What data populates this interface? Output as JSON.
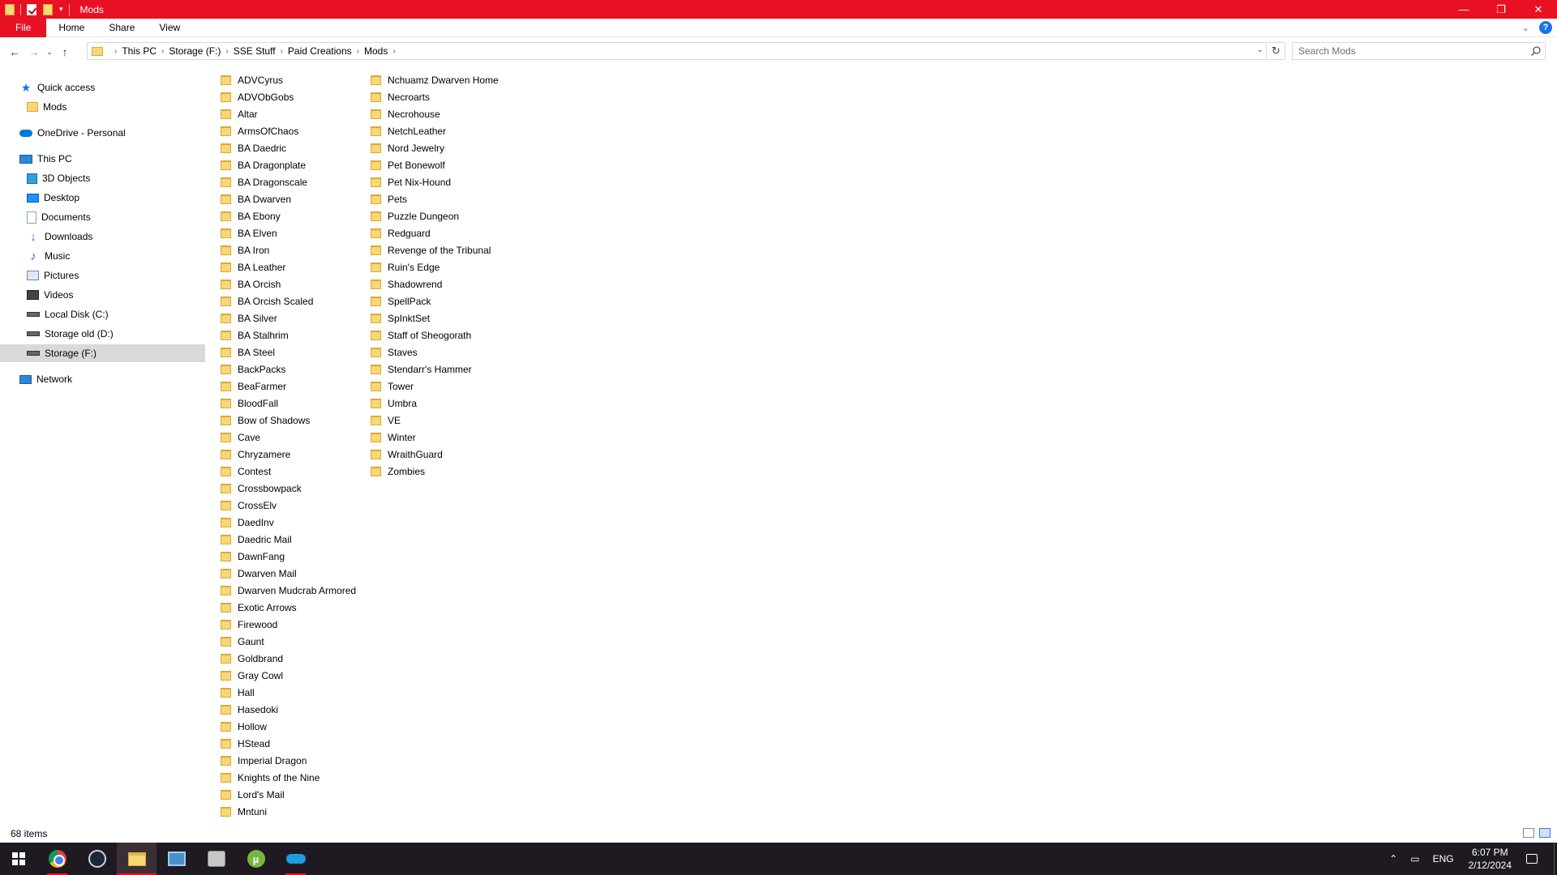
{
  "window": {
    "title": "Mods",
    "accent": "#e81123",
    "controls": {
      "minimize": "—",
      "restore": "❐",
      "close": "✕"
    }
  },
  "ribbon": {
    "tabs": [
      "File",
      "Home",
      "Share",
      "View"
    ],
    "help": "?"
  },
  "address": {
    "breadcrumb": [
      "This PC",
      "Storage (F:)",
      "SSE Stuff",
      "Paid Creations",
      "Mods"
    ],
    "search_placeholder": "Search Mods"
  },
  "nav": {
    "quick_access": "Quick access",
    "quick_items": [
      "Mods"
    ],
    "onedrive": "OneDrive - Personal",
    "this_pc": "This PC",
    "pc_items": [
      "3D Objects",
      "Desktop",
      "Documents",
      "Downloads",
      "Music",
      "Pictures",
      "Videos",
      "Local Disk (C:)",
      "Storage old (D:)",
      "Storage (F:)"
    ],
    "network": "Network",
    "selected": "Storage (F:)"
  },
  "files": {
    "column1": [
      "ADVCyrus",
      "ADVObGobs",
      "Altar",
      "ArmsOfChaos",
      "BA Daedric",
      "BA Dragonplate",
      "BA Dragonscale",
      "BA Dwarven",
      "BA Ebony",
      "BA Elven",
      "BA Iron",
      "BA Leather",
      "BA Orcish",
      "BA Orcish Scaled",
      "BA Silver",
      "BA Stalhrim",
      "BA Steel",
      "BackPacks",
      "BeaFarmer",
      "BloodFall",
      "Bow of Shadows",
      "Cave",
      "Chryzamere",
      "Contest",
      "Crossbowpack",
      "CrossElv",
      "DaedInv",
      "Daedric Mail",
      "DawnFang",
      "Dwarven Mail",
      "Dwarven Mudcrab Armored",
      "Exotic Arrows",
      "Firewood",
      "Gaunt",
      "Goldbrand",
      "Gray Cowl",
      "Hall",
      "Hasedoki",
      "Hollow",
      "HStead",
      "Imperial Dragon",
      "Knights of the Nine",
      "Lord's Mail",
      "Mntuni"
    ],
    "column2": [
      "Nchuamz Dwarven Home",
      "Necroarts",
      "Necrohouse",
      "NetchLeather",
      "Nord Jewelry",
      "Pet Bonewolf",
      "Pet Nix-Hound",
      "Pets",
      "Puzzle Dungeon",
      "Redguard",
      "Revenge of the Tribunal",
      "Ruin's Edge",
      "Shadowrend",
      "SpellPack",
      "SpInktSet",
      "Staff of Sheogorath",
      "Staves",
      "Stendarr's Hammer",
      "Tower",
      "Umbra",
      "VE",
      "Winter",
      "WraithGuard",
      "Zombies"
    ]
  },
  "status": {
    "items_count": "68 items"
  },
  "taskbar": {
    "apps": [
      "start-icon",
      "chrome-icon",
      "steam-icon",
      "file-explorer-icon",
      "app-icon",
      "app-icon",
      "utorrent-icon",
      "app-icon"
    ],
    "lang": "ENG",
    "time": "6:07 PM",
    "date": "2/12/2024"
  }
}
